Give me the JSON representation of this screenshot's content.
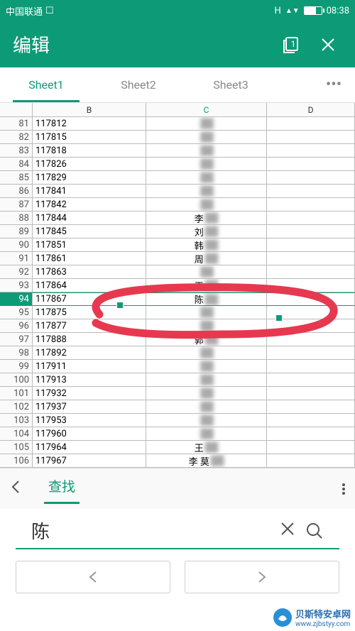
{
  "status": {
    "carrier": "中国联通",
    "time": "08:38",
    "net": "H"
  },
  "appbar": {
    "title": "编辑",
    "pages_label": "1"
  },
  "tabs": [
    "Sheet1",
    "Sheet2",
    "Sheet3"
  ],
  "columns": [
    "B",
    "C",
    "D"
  ],
  "selected_row": 94,
  "rows": [
    {
      "n": 81,
      "b": "117812",
      "c": ""
    },
    {
      "n": 82,
      "b": "117815",
      "c": ""
    },
    {
      "n": 83,
      "b": "117818",
      "c": ""
    },
    {
      "n": 84,
      "b": "117826",
      "c": ""
    },
    {
      "n": 85,
      "b": "117829",
      "c": ""
    },
    {
      "n": 86,
      "b": "117841",
      "c": ""
    },
    {
      "n": 87,
      "b": "117842",
      "c": ""
    },
    {
      "n": 88,
      "b": "117844",
      "c": "李"
    },
    {
      "n": 89,
      "b": "117845",
      "c": "刘"
    },
    {
      "n": 90,
      "b": "117851",
      "c": "韩"
    },
    {
      "n": 91,
      "b": "117861",
      "c": "周"
    },
    {
      "n": 92,
      "b": "117863",
      "c": ""
    },
    {
      "n": 93,
      "b": "117864",
      "c": "王"
    },
    {
      "n": 94,
      "b": "117867",
      "c": "陈"
    },
    {
      "n": 95,
      "b": "117875",
      "c": ""
    },
    {
      "n": 96,
      "b": "117877",
      "c": ""
    },
    {
      "n": 97,
      "b": "117888",
      "c": "郭"
    },
    {
      "n": 98,
      "b": "117892",
      "c": ""
    },
    {
      "n": 99,
      "b": "117911",
      "c": ""
    },
    {
      "n": 100,
      "b": "117913",
      "c": ""
    },
    {
      "n": 101,
      "b": "117932",
      "c": ""
    },
    {
      "n": 102,
      "b": "117937",
      "c": ""
    },
    {
      "n": 103,
      "b": "117953",
      "c": ""
    },
    {
      "n": 104,
      "b": "117960",
      "c": ""
    },
    {
      "n": 105,
      "b": "117964",
      "c": "王"
    },
    {
      "n": 106,
      "b": "117967",
      "c": "李  莫"
    }
  ],
  "find": {
    "tab": "查找",
    "value": "陈"
  },
  "watermark": {
    "line1": "贝斯特安卓网",
    "line2": "www.zjbstyy.com"
  }
}
